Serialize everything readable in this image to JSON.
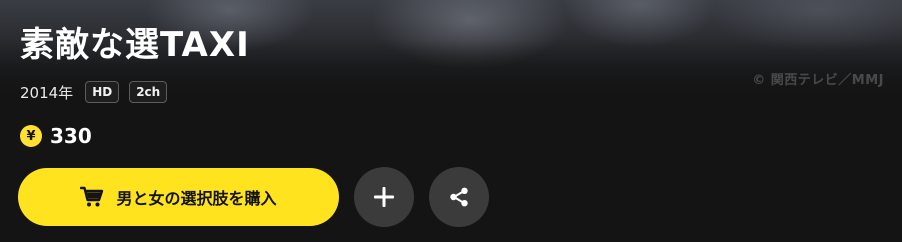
{
  "title": "素敵な選TAXI",
  "copyright": "© 関西テレビ／MMJ",
  "meta": {
    "year": "2014年",
    "badges": [
      "HD",
      "2ch"
    ]
  },
  "price": {
    "currency_symbol": "¥",
    "amount": "330"
  },
  "actions": {
    "buy_label": "男と女の選択肢を購入",
    "buy_icon": "cart-icon",
    "add_icon": "plus-icon",
    "share_icon": "share-icon"
  },
  "colors": {
    "accent": "#ffe31f",
    "background": "#141414",
    "circle_button": "#3b3b3b"
  }
}
